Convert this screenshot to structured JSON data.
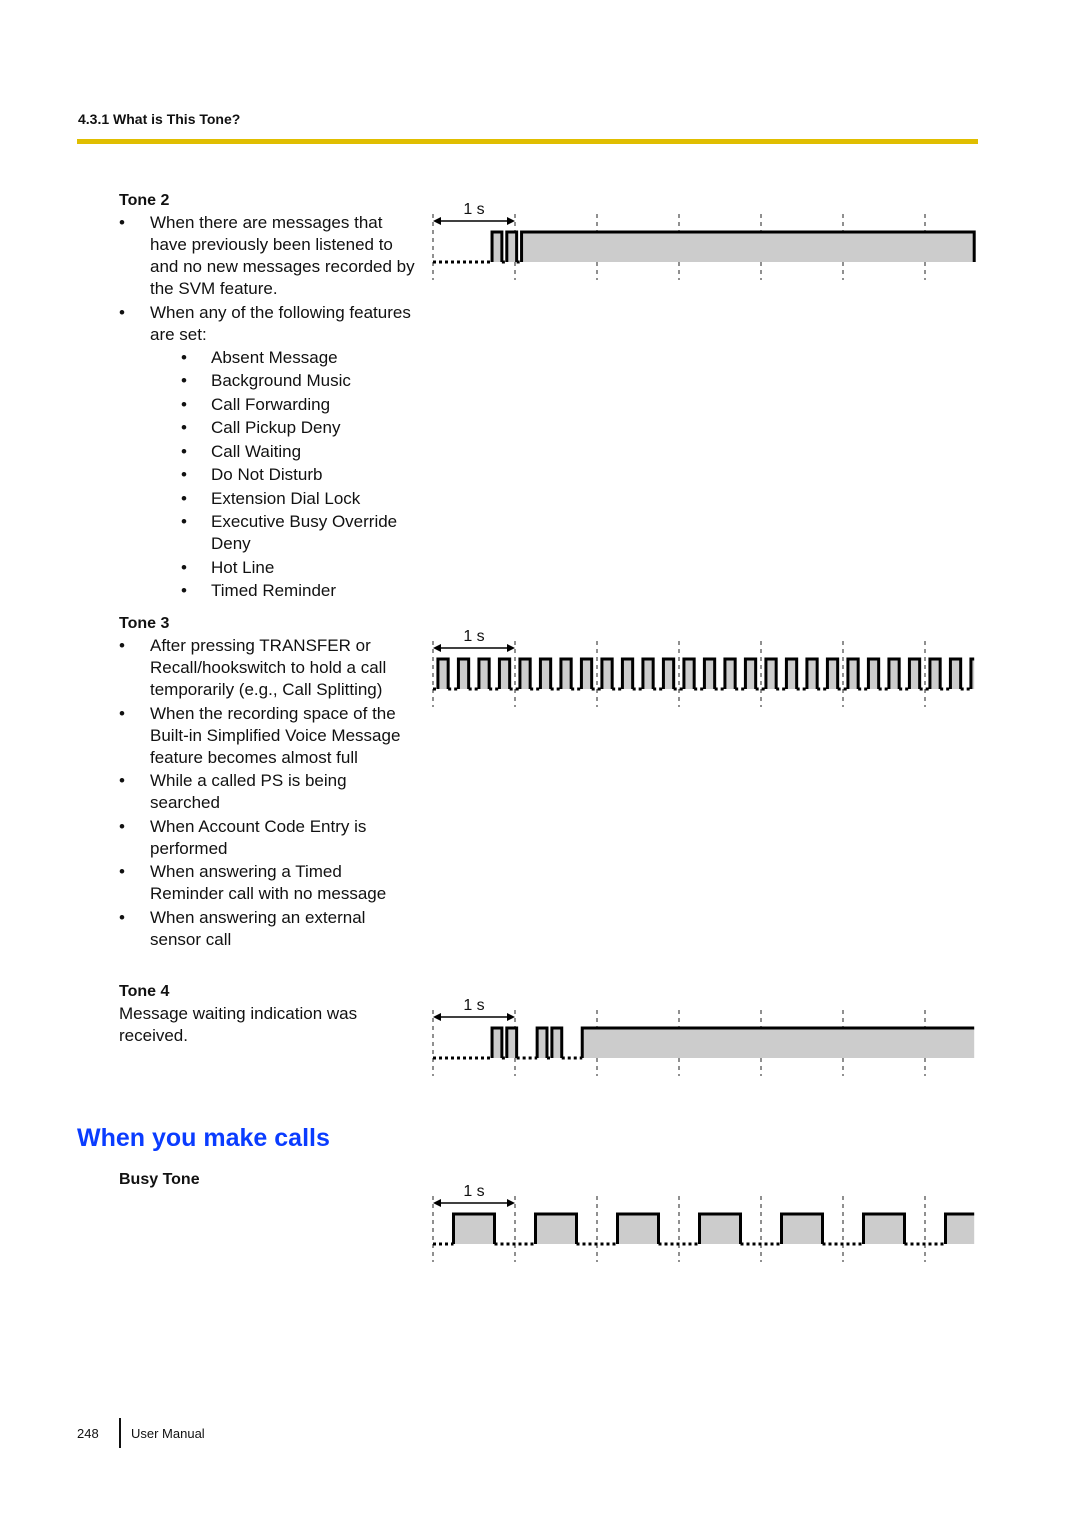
{
  "header": {
    "section": "4.3.1 What is This Tone?",
    "rule_color": "#e0be00"
  },
  "tones": [
    {
      "id": "tone2",
      "title": "Tone 2",
      "bullets": [
        {
          "text": "When there are messages that have previously been listened to and no new messages recorded by the SVM feature."
        },
        {
          "text": "When any of the following features are set:",
          "sub": [
            "Absent Message",
            "Background Music",
            "Call Forwarding",
            "Call Pickup Deny",
            "Call Waiting",
            "Do Not Disturb",
            "Extension Dial Lock",
            "Executive Busy Override Deny",
            "Hot Line",
            "Timed Reminder"
          ]
        }
      ],
      "diagram": {
        "scale_label": "1 s",
        "duration_s": 6.6,
        "segments": [
          [
            "off",
            0.72
          ],
          [
            "on",
            0.12
          ],
          [
            "off",
            0.06
          ],
          [
            "on",
            0.12
          ],
          [
            "off",
            0.06
          ],
          [
            "on",
            5.52
          ]
        ]
      }
    },
    {
      "id": "tone3",
      "title": "Tone 3",
      "bullets": [
        {
          "text": "After pressing TRANSFER or Recall/hookswitch to hold a call temporarily (e.g., Call Splitting)"
        },
        {
          "text": "When the recording space of the Built-in Simplified Voice Message feature becomes almost full"
        },
        {
          "text": "While a called PS is being searched"
        },
        {
          "text": "When Account Code Entry is performed"
        },
        {
          "text": "When answering a Timed Reminder call with no message"
        },
        {
          "text": "When answering an external sensor call"
        }
      ],
      "diagram": {
        "scale_label": "1 s",
        "duration_s": 6.6,
        "pattern": {
          "lead_off": 0.06,
          "on": 0.125,
          "off": 0.125
        }
      }
    },
    {
      "id": "tone4",
      "title": "Tone 4",
      "description": "Message waiting indication was received.",
      "diagram": {
        "scale_label": "1 s",
        "duration_s": 6.6,
        "segments": [
          [
            "off",
            0.72
          ],
          [
            "on",
            0.12
          ],
          [
            "off",
            0.06
          ],
          [
            "on",
            0.12
          ],
          [
            "off",
            0.25
          ],
          [
            "on",
            0.12
          ],
          [
            "off",
            0.06
          ],
          [
            "on",
            0.12
          ],
          [
            "off",
            0.25
          ],
          [
            "on",
            4.78
          ]
        ]
      }
    }
  ],
  "make_calls": {
    "heading": "When you make calls",
    "heading_color": "#0a3cff",
    "busy": {
      "title": "Busy Tone",
      "diagram": {
        "scale_label": "1 s",
        "duration_s": 6.6,
        "pattern": {
          "lead_off": 0.25,
          "on": 0.5,
          "off": 0.5
        }
      }
    }
  },
  "footer": {
    "page_number": "248",
    "doc_title": "User Manual"
  }
}
